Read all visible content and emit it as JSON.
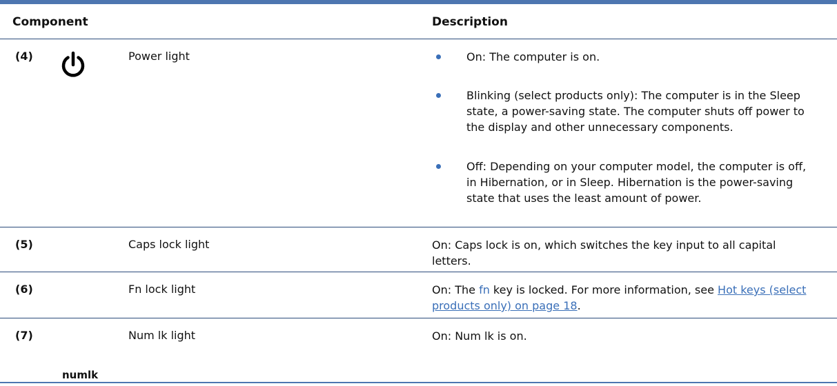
{
  "table": {
    "headers": {
      "component": "Component",
      "description": "Description"
    },
    "rows": [
      {
        "number": "(4)",
        "icon": "power-icon",
        "name": "Power light",
        "bullets": [
          "On: The computer is on.",
          "Blinking (select products only): The computer is in the Sleep state, a power-saving state. The computer shuts off power to the display and other unnecessary components.",
          "Off: Depending on your computer model, the computer is off, in Hibernation, or in Sleep. Hibernation is the power-saving state that uses the least amount of power."
        ]
      },
      {
        "number": "(5)",
        "name": "Caps lock light",
        "description": "On: Caps lock is on, which switches the key input to all capital letters."
      },
      {
        "number": "(6)",
        "name": "Fn lock light",
        "description_prefix": "On: The ",
        "fn_key": "fn",
        "description_middle": " key is locked. For more information, see ",
        "link_text": "Hot keys (select products only) on page 18",
        "description_suffix": "."
      },
      {
        "number": "(7)",
        "icon_label": "numlk",
        "name": "Num lk light",
        "description": "On: Num lk is on."
      }
    ]
  },
  "colors": {
    "rule": "#4d76b0",
    "bullet": "#3a6fb8",
    "link": "#3a6fb8"
  }
}
